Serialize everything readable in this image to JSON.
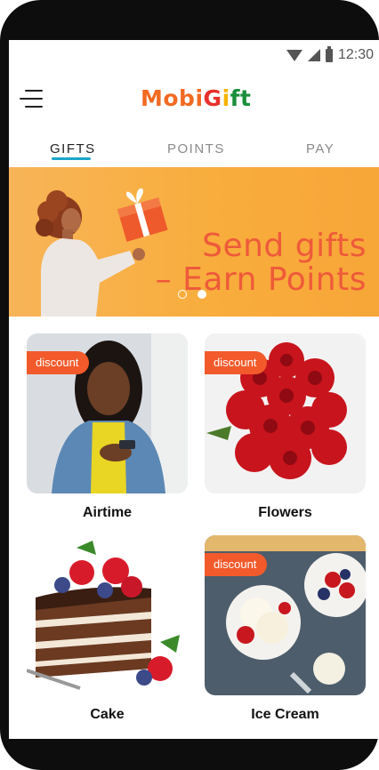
{
  "status_bar": {
    "time": "12:30",
    "icons": [
      "wifi-icon",
      "signal-icon",
      "battery-icon"
    ]
  },
  "header": {
    "menu_icon": "menu-icon",
    "logo": {
      "part1": "Mobi",
      "part2": "G",
      "part3": "i",
      "part4": "ft"
    }
  },
  "tabs": [
    {
      "label": "GIFTS",
      "active": true
    },
    {
      "label": "POINTS",
      "active": false
    },
    {
      "label": "PAY",
      "active": false
    }
  ],
  "banner": {
    "line1": "Send gifts",
    "line2": "– Earn Points",
    "slides": 2,
    "active_slide": 2
  },
  "gifts": [
    {
      "label": "Airtime",
      "badge": "discount"
    },
    {
      "label": "Flowers",
      "badge": "discount"
    },
    {
      "label": "Cake",
      "badge": ""
    },
    {
      "label": "Ice Cream",
      "badge": "discount"
    }
  ],
  "colors": {
    "accent": "#1aa6c9",
    "banner": "#f8ad3c",
    "badge": "#f25a2b",
    "banner_text": "#ee5a3a"
  }
}
